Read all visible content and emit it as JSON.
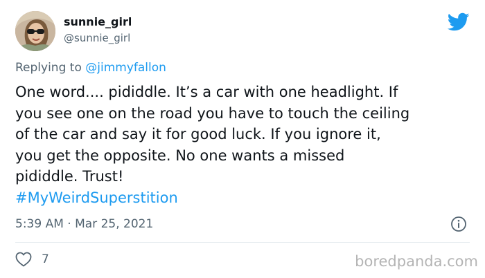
{
  "user": {
    "display_name": "sunnie_girl",
    "handle": "@sunnie_girl",
    "avatar_icon": "profile-photo"
  },
  "reply": {
    "prefix": "Replying to",
    "mention": "@jimmyfallon"
  },
  "tweet": {
    "lines": [
      "One word.... pididdle. It’s a car with one headlight. If",
      "you see one on the road you have to touch the ceiling",
      "of the car and say it for good luck. If you ignore it,",
      "you get the opposite. No one wants a missed",
      "pididdle. Trust!"
    ],
    "hashtag": "#MyWeirdSuperstition",
    "timestamp": "5:39 AM · Mar 25, 2021"
  },
  "actions": {
    "like_count": "7"
  },
  "watermark": "boredpanda.com",
  "colors": {
    "accent": "#1d9bf0",
    "muted": "#536471",
    "text": "#0f1419",
    "divider": "#e6ecf0",
    "watermark": "#b4b4b4"
  }
}
